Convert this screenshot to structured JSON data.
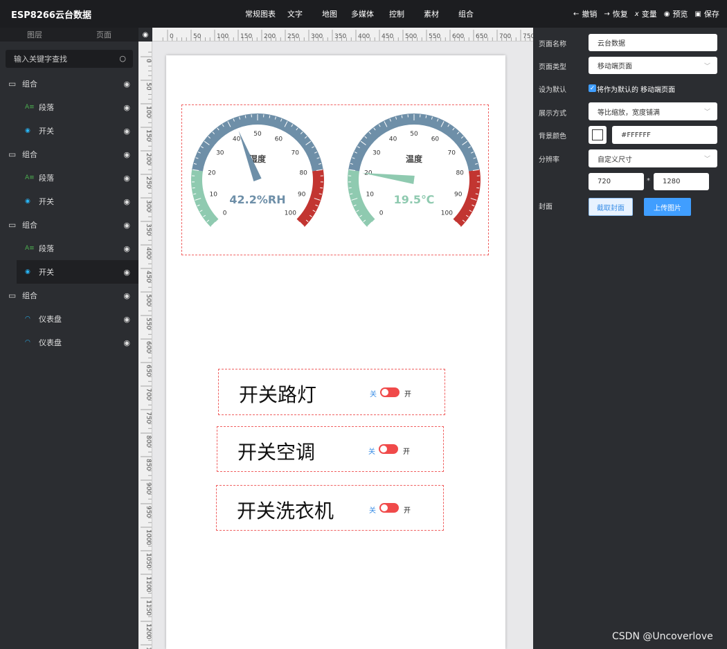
{
  "app": {
    "title": "ESP8266云台数据"
  },
  "topnav": [
    "常规图表",
    "文字",
    "地图",
    "多媒体",
    "控制",
    "素材",
    "组合"
  ],
  "actions": [
    {
      "icon": "undo-arrow-icon",
      "glyph": "←",
      "label": "撤销"
    },
    {
      "icon": "redo-arrow-icon",
      "glyph": "→",
      "label": "恢复"
    },
    {
      "icon": "variable-icon",
      "glyph": "x",
      "label": "变量"
    },
    {
      "icon": "preview-eye-icon",
      "glyph": "◉",
      "label": "预览"
    },
    {
      "icon": "save-icon",
      "glyph": "▣",
      "label": "保存"
    }
  ],
  "left": {
    "tabs": [
      "图层",
      "页面"
    ],
    "search_placeholder": "输入关键字查找",
    "layers": [
      {
        "type": "group",
        "label": "组合"
      },
      {
        "type": "paragraph",
        "label": "段落"
      },
      {
        "type": "switch",
        "label": "开关"
      },
      {
        "type": "group",
        "label": "组合"
      },
      {
        "type": "paragraph",
        "label": "段落"
      },
      {
        "type": "switch",
        "label": "开关"
      },
      {
        "type": "group",
        "label": "组合"
      },
      {
        "type": "paragraph",
        "label": "段落"
      },
      {
        "type": "switch",
        "label": "开关",
        "selected": true
      },
      {
        "type": "group",
        "label": "组合"
      },
      {
        "type": "gauge",
        "label": "仪表盘"
      },
      {
        "type": "gauge",
        "label": "仪表盘"
      }
    ]
  },
  "ruler": {
    "top_ticks": [
      "0",
      "50",
      "100",
      "150",
      "200",
      "250",
      "300",
      "350",
      "400",
      "450",
      "500",
      "550",
      "600",
      "650",
      "700",
      "750"
    ],
    "left_ticks": [
      "0",
      "50",
      "100",
      "150",
      "200",
      "250",
      "300",
      "350",
      "400",
      "450",
      "500",
      "550",
      "600",
      "650",
      "700",
      "750",
      "800",
      "850",
      "900",
      "950",
      "1000",
      "1050",
      "1100",
      "1150",
      "1200",
      "12"
    ]
  },
  "gauges": [
    {
      "title": "湿度",
      "value": 42.2,
      "unit": "%RH",
      "display": "42.2%RH",
      "min": 0,
      "max": 100,
      "ticks": [
        "0",
        "10",
        "20",
        "30",
        "40",
        "50",
        "60",
        "70",
        "80",
        "90",
        "100"
      ],
      "needle_color": "#6e8fa8",
      "value_color": "#6e8fa8"
    },
    {
      "title": "温度",
      "value": 19.5,
      "unit": "℃",
      "display": "19.5℃",
      "min": 0,
      "max": 100,
      "ticks": [
        "0",
        "10",
        "20",
        "30",
        "40",
        "50",
        "60",
        "70",
        "80",
        "90",
        "100"
      ],
      "needle_color": "#8fcab0",
      "value_color": "#8fcab0"
    }
  ],
  "gauge_colors": {
    "low": "#8fcab0",
    "mid": "#6e8fa8",
    "high": "#c23531"
  },
  "switches": [
    {
      "label": "开关路灯",
      "off": "关",
      "on": "开"
    },
    {
      "label": "开关空调",
      "off": "关",
      "on": "开"
    },
    {
      "label": "开关洗衣机",
      "off": "关",
      "on": "开"
    }
  ],
  "right": {
    "page_name_label": "页面名称",
    "page_name_value": "云台数据",
    "page_type_label": "页面类型",
    "page_type_value": "移动端页面",
    "default_label": "设为默认",
    "default_text": "将作为默认的 移动端页面",
    "display_label": "展示方式",
    "display_value": "等比缩放，宽度铺满",
    "bg_label": "背景颜色",
    "bg_value": "#FFFFFF",
    "res_label": "分辨率",
    "res_mode": "自定义尺寸",
    "res_w": "720",
    "res_sep": "*",
    "res_h": "1280",
    "cover_label": "封面",
    "capture_btn": "截取封面",
    "upload_btn": "上传图片"
  },
  "watermark": "CSDN @Uncoverlove"
}
